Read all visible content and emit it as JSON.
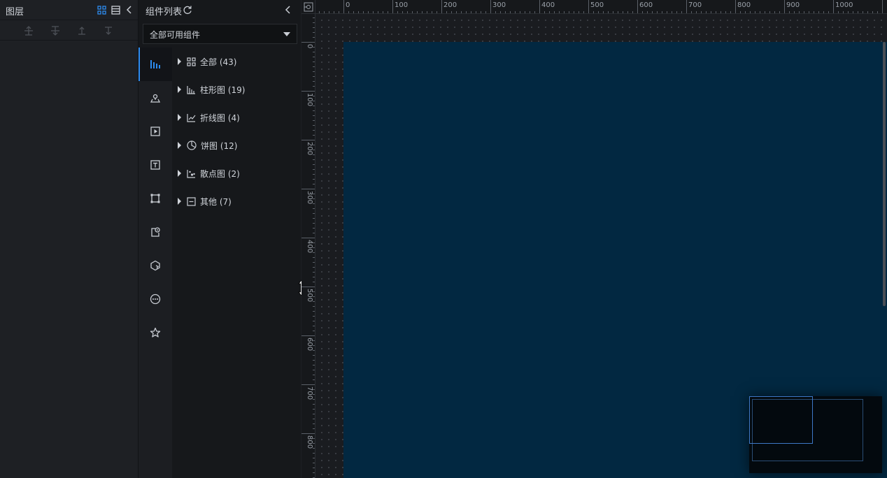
{
  "layers_panel": {
    "title": "图层",
    "header_icons": [
      "grid-view-icon",
      "list-view-icon",
      "collapse-left-icon"
    ],
    "tools": [
      "move-top-icon",
      "move-bottom-icon",
      "move-up-icon",
      "move-down-icon"
    ]
  },
  "components_panel": {
    "title": "组件列表",
    "filter": {
      "selected": "全部可用组件"
    },
    "categories_rail": [
      {
        "icon": "bar-chart-icon",
        "active": true
      },
      {
        "icon": "map-icon",
        "active": false
      },
      {
        "icon": "media-play-icon",
        "active": false
      },
      {
        "icon": "text-icon",
        "active": false
      },
      {
        "icon": "shape-frame-icon",
        "active": false
      },
      {
        "icon": "interaction-icon",
        "active": false
      },
      {
        "icon": "material-icon",
        "active": false
      },
      {
        "icon": "other-circle-icon",
        "active": false
      },
      {
        "icon": "favorite-star-icon",
        "active": false
      }
    ],
    "tree": [
      {
        "label": "全部 (43)",
        "icon": "grid-icon"
      },
      {
        "label": "柱形图 (19)",
        "icon": "bar-icon"
      },
      {
        "label": "折线图 (4)",
        "icon": "line-icon"
      },
      {
        "label": "饼图 (12)",
        "icon": "pie-icon"
      },
      {
        "label": "散点图 (2)",
        "icon": "scatter-icon"
      },
      {
        "label": "其他 (7)",
        "icon": "other-icon"
      }
    ]
  },
  "rulers": {
    "horizontal": [
      "0",
      "100",
      "200",
      "300",
      "400",
      "500",
      "600",
      "700",
      "800",
      "900",
      "1000"
    ],
    "vertical": [
      "0",
      "100",
      "200",
      "300",
      "400",
      "500",
      "600",
      "700",
      "800"
    ]
  },
  "colors": {
    "accent": "#2d8cf0",
    "screen_bg": "#022841",
    "panel_bg": "#1e2024"
  }
}
